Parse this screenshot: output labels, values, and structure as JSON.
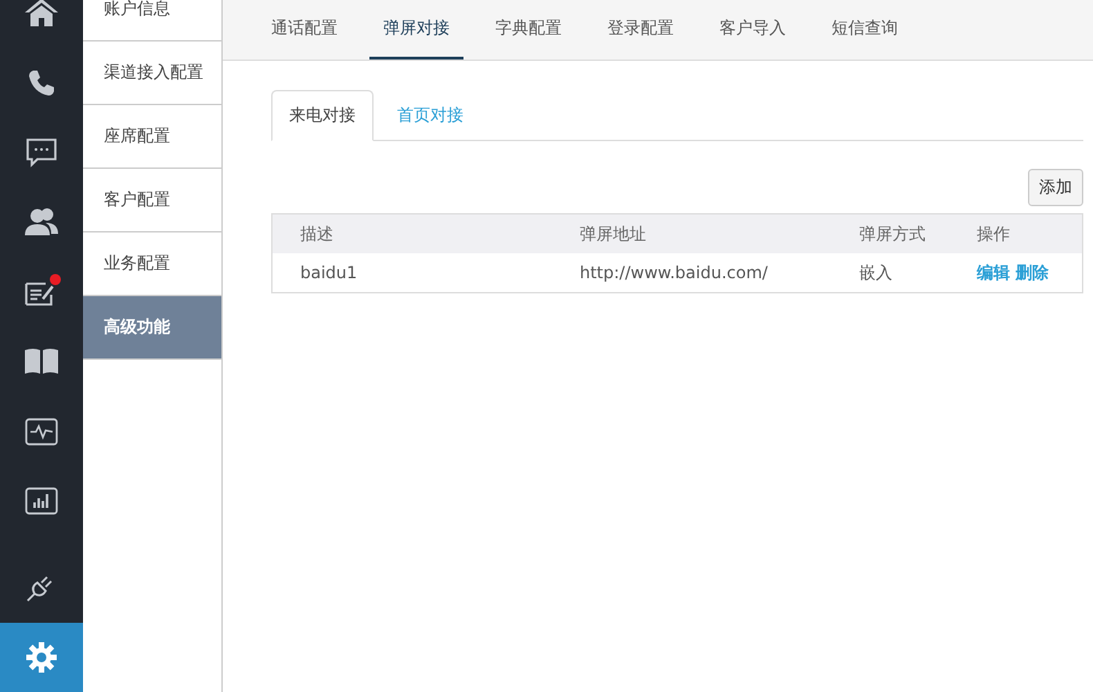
{
  "rail": [
    {
      "kind": "home",
      "selected": false,
      "notification": false
    },
    {
      "kind": "phone",
      "selected": false,
      "notification": false
    },
    {
      "kind": "chat",
      "selected": false,
      "notification": false
    },
    {
      "kind": "people",
      "selected": false,
      "notification": false
    },
    {
      "kind": "note",
      "selected": false,
      "notification": true
    },
    {
      "kind": "book",
      "selected": false,
      "notification": false
    },
    {
      "kind": "monitor",
      "selected": false,
      "notification": false
    },
    {
      "kind": "chart",
      "selected": false,
      "notification": false
    },
    {
      "kind": "plug",
      "selected": false,
      "notification": false
    },
    {
      "kind": "gear",
      "selected": true,
      "notification": false
    }
  ],
  "sidebar": {
    "items": [
      {
        "label": "账户信息",
        "selected": false
      },
      {
        "label": "渠道接入配置",
        "selected": false
      },
      {
        "label": "座席配置",
        "selected": false
      },
      {
        "label": "客户配置",
        "selected": false
      },
      {
        "label": "业务配置",
        "selected": false
      },
      {
        "label": "高级功能",
        "selected": true
      }
    ]
  },
  "tabs": [
    {
      "label": "通话配置",
      "selected": false
    },
    {
      "label": "弹屏对接",
      "selected": true
    },
    {
      "label": "字典配置",
      "selected": false
    },
    {
      "label": "登录配置",
      "selected": false
    },
    {
      "label": "客户导入",
      "selected": false
    },
    {
      "label": "短信查询",
      "selected": false
    }
  ],
  "subtabs": [
    {
      "label": "来电对接",
      "selected": true
    },
    {
      "label": "首页对接",
      "selected": false
    }
  ],
  "add_button": "添加",
  "table": {
    "columns": [
      "描述",
      "弹屏地址",
      "弹屏方式",
      "操作"
    ],
    "rows": [
      {
        "cells": [
          "baidu1",
          "http://www.baidu.com/",
          "嵌入"
        ],
        "actions": [
          "编辑",
          "删除"
        ]
      }
    ]
  }
}
